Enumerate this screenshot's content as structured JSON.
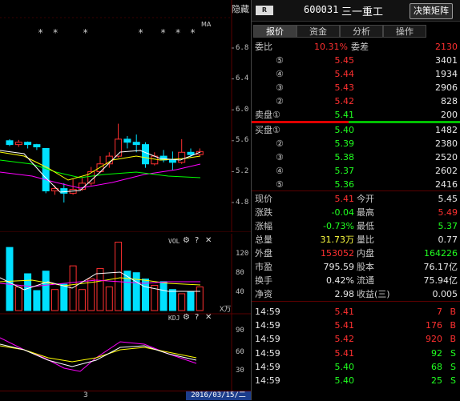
{
  "chart": {
    "hide_label": "隐藏",
    "ma_label": "MA",
    "price_axis": [
      "6.8",
      "6.4",
      "6.0",
      "5.6",
      "5.2",
      "4.8"
    ],
    "vol_title": "VOL",
    "vol_axis": [
      "120",
      "80",
      "40"
    ],
    "vol_unit": "X万",
    "kdj_title": "KDJ",
    "kdj_axis": [
      "90",
      "60",
      "30"
    ],
    "bottom_number": "3",
    "date": "2016/03/15/二",
    "stars": [
      "* *",
      "*",
      "*",
      "* * *"
    ],
    "colors": {
      "up": "#ff3030",
      "down": "#00e0ff",
      "ma5": "#ffffff",
      "ma10": "#ffff00",
      "ma20": "#ff00ff",
      "ma30": "#00ff00"
    }
  },
  "quote": {
    "r_badge": "R",
    "code": "600031",
    "name": "三一重工",
    "decision_button": "决策矩阵",
    "tabs": [
      "报价",
      "资金",
      "分析",
      "操作"
    ],
    "weibi": {
      "label": "委比",
      "pct": "10.31%",
      "wc_label": "委差",
      "wc_val": "2130"
    },
    "sell": [
      {
        "label": "⑤",
        "price": "5.45",
        "vol": "3401"
      },
      {
        "label": "④",
        "price": "5.44",
        "vol": "1934"
      },
      {
        "label": "③",
        "price": "5.43",
        "vol": "2906"
      },
      {
        "label": "②",
        "price": "5.42",
        "vol": "828"
      },
      {
        "label": "卖盘①",
        "price": "5.41",
        "vol": "200"
      }
    ],
    "buy": [
      {
        "label": "买盘①",
        "price": "5.40",
        "vol": "1482"
      },
      {
        "label": "②",
        "price": "5.39",
        "vol": "2380"
      },
      {
        "label": "③",
        "price": "5.38",
        "vol": "2520"
      },
      {
        "label": "④",
        "price": "5.37",
        "vol": "2602"
      },
      {
        "label": "⑤",
        "price": "5.36",
        "vol": "2416"
      }
    ],
    "stats": [
      {
        "l1": "现价",
        "v1": "5.41",
        "c1": "red",
        "l2": "今开",
        "v2": "5.45",
        "c2": "white"
      },
      {
        "l1": "涨跌",
        "v1": "-0.04",
        "c1": "green",
        "l2": "最高",
        "v2": "5.49",
        "c2": "red"
      },
      {
        "l1": "涨幅",
        "v1": "-0.73%",
        "c1": "green",
        "l2": "最低",
        "v2": "5.37",
        "c2": "green"
      },
      {
        "l1": "总量",
        "v1": "31.73万",
        "c1": "yellow",
        "l2": "量比",
        "v2": "0.77",
        "c2": "white"
      },
      {
        "l1": "外盘",
        "v1": "153052",
        "c1": "red",
        "l2": "内盘",
        "v2": "164226",
        "c2": "green"
      },
      {
        "l1": "市盈",
        "v1": "795.59",
        "c1": "white",
        "l2": "股本",
        "v2": "76.17亿",
        "c2": "white"
      },
      {
        "l1": "换手",
        "v1": "0.42%",
        "c1": "white",
        "l2": "流通",
        "v2": "75.94亿",
        "c2": "white"
      },
      {
        "l1": "净资",
        "v1": "2.98",
        "c1": "white",
        "l2": "收益(三)",
        "v2": "0.005",
        "c2": "white"
      }
    ],
    "ticks": [
      {
        "time": "14:59",
        "price": "5.41",
        "pc": "red",
        "vol": "7",
        "vc": "red",
        "side": "B",
        "sc": "red"
      },
      {
        "time": "14:59",
        "price": "5.41",
        "pc": "red",
        "vol": "176",
        "vc": "red",
        "side": "B",
        "sc": "red"
      },
      {
        "time": "14:59",
        "price": "5.42",
        "pc": "red",
        "vol": "920",
        "vc": "red",
        "side": "B",
        "sc": "red"
      },
      {
        "time": "14:59",
        "price": "5.41",
        "pc": "red",
        "vol": "92",
        "vc": "green",
        "side": "S",
        "sc": "green"
      },
      {
        "time": "14:59",
        "price": "5.40",
        "pc": "green",
        "vol": "68",
        "vc": "green",
        "side": "S",
        "sc": "green"
      },
      {
        "time": "14:59",
        "price": "5.40",
        "pc": "green",
        "vol": "25",
        "vc": "green",
        "side": "S",
        "sc": "green"
      }
    ]
  }
}
